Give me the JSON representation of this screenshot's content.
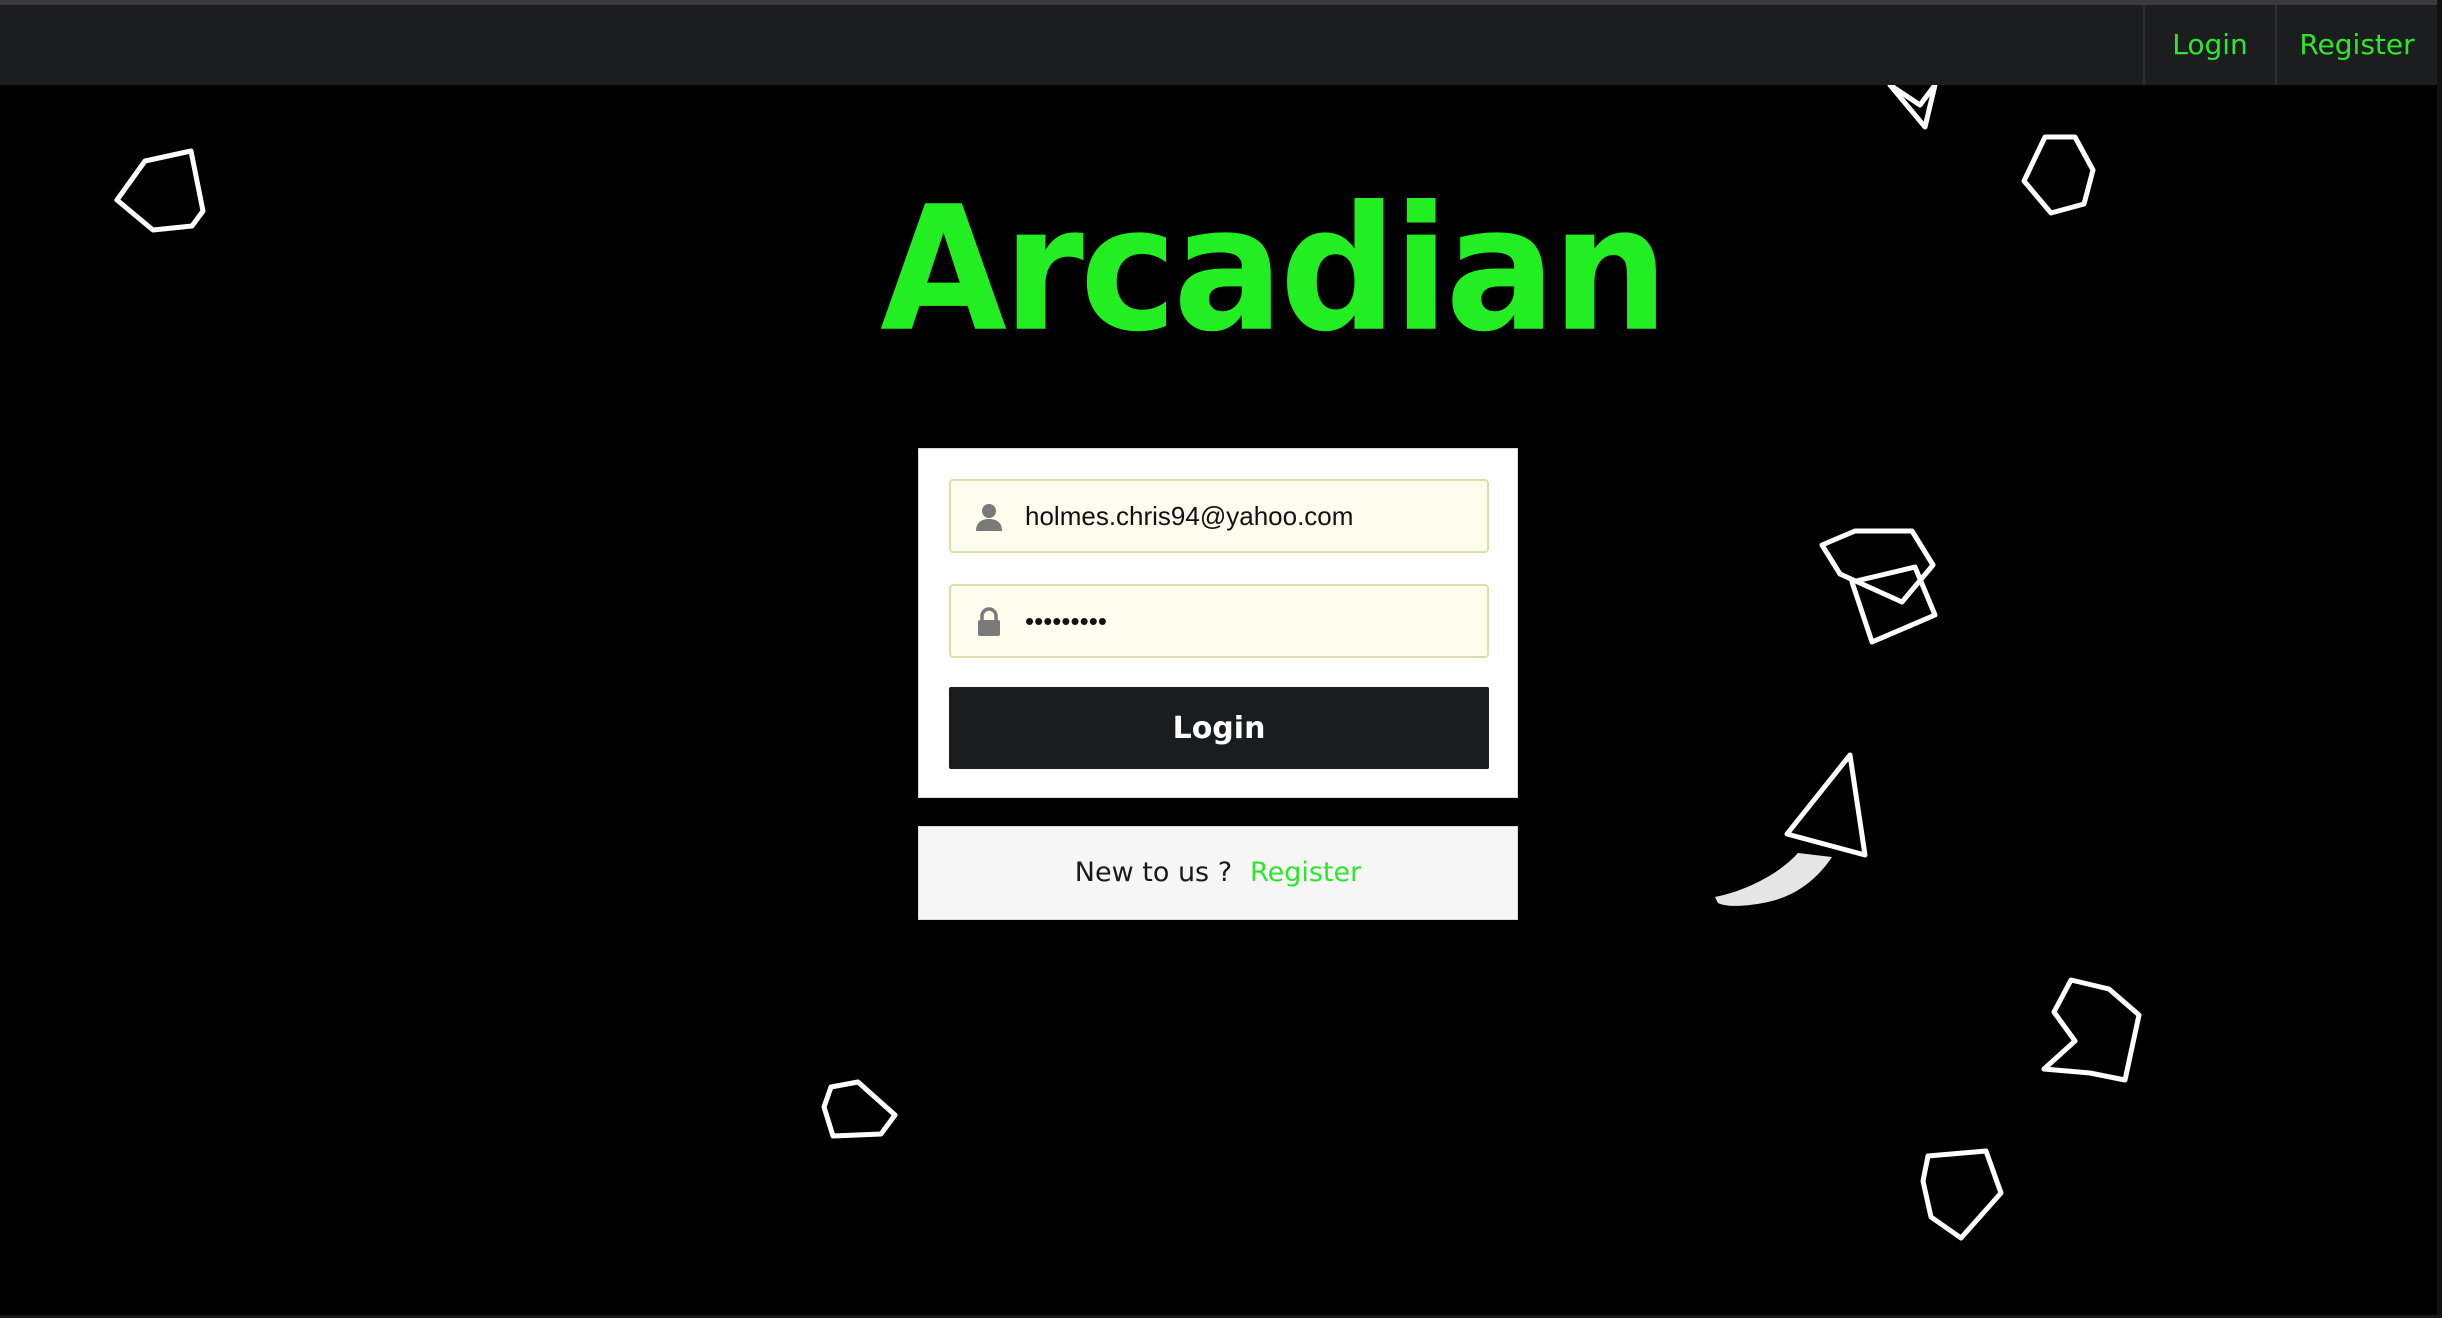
{
  "navbar": {
    "login_label": "Login",
    "register_label": "Register"
  },
  "app": {
    "title": "Arcadian"
  },
  "login_form": {
    "email_value": "holmes.chris94@yahoo.com",
    "password_value": "password1",
    "submit_label": "Login"
  },
  "register_prompt": {
    "text": "New to us ?",
    "link_label": "Register"
  },
  "icons": {
    "user": "user-icon",
    "lock": "lock-icon"
  },
  "colors": {
    "accent": "#22ee22",
    "background": "#000000",
    "navbar": "#1c1d1f",
    "button": "#1b1c1e",
    "field_background": "#fdfdee"
  }
}
